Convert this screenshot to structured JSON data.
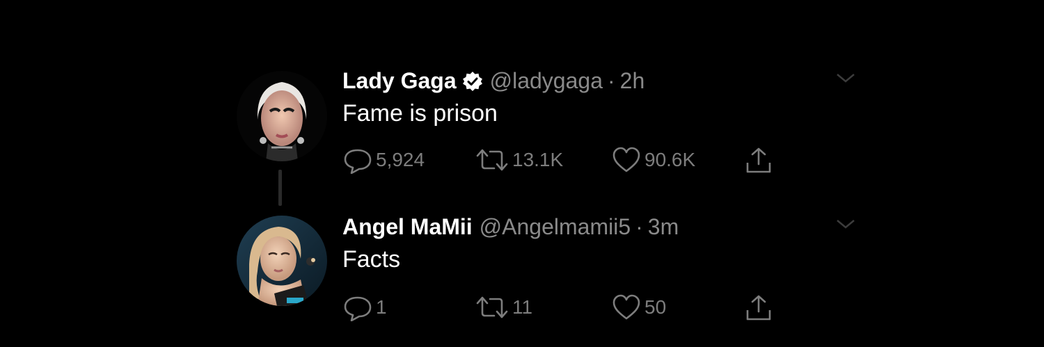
{
  "tweets": [
    {
      "display_name": "Lady Gaga",
      "verified": true,
      "handle": "@ladygaga",
      "separator": "·",
      "time": "2h",
      "text": "Fame is prison",
      "replies": "5,924",
      "retweets": "13.1K",
      "likes": "90.6K"
    },
    {
      "display_name": "Angel MaMii",
      "verified": false,
      "handle": "@Angelmamii5",
      "separator": "·",
      "time": "3m",
      "text": "Facts",
      "replies": "1",
      "retweets": "11",
      "likes": "50"
    }
  ],
  "icons": {
    "reply": "speech-bubble-icon",
    "retweet": "retweet-arrows-icon",
    "like": "heart-icon",
    "share": "share-upload-icon",
    "more": "chevron-down-icon",
    "verified": "verified-badge-icon"
  },
  "colors": {
    "background": "#000000",
    "primary_text": "#ffffff",
    "secondary_text": "#8a8a8a",
    "icon": "#7d7d7d"
  }
}
